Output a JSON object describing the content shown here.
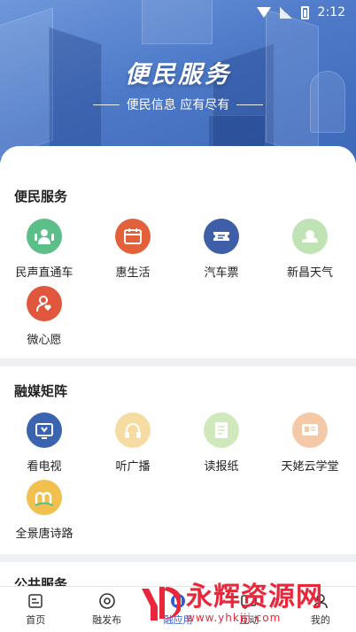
{
  "status_bar": {
    "time": "2:12"
  },
  "hero": {
    "title": "便民服务",
    "subtitle": "便民信息 应有尽有"
  },
  "sections": [
    {
      "title": "便民服务",
      "items": [
        {
          "label": "民声直通车",
          "icon": "people-voice-icon",
          "color": "#5cbf8a"
        },
        {
          "label": "惠生活",
          "icon": "calendar-life-icon",
          "color": "#e2613a"
        },
        {
          "label": "汽车票",
          "icon": "ticket-icon",
          "color": "#3e5ea8"
        },
        {
          "label": "新昌天气",
          "icon": "weather-icon",
          "color": "#bfe3b4"
        },
        {
          "label": "微心愿",
          "icon": "heart-wish-icon",
          "color": "#e0573e"
        }
      ]
    },
    {
      "title": "融媒矩阵",
      "items": [
        {
          "label": "看电视",
          "icon": "tv-icon",
          "color": "#3a63b0"
        },
        {
          "label": "听广播",
          "icon": "headphones-icon",
          "color": "#f6dca3"
        },
        {
          "label": "读报纸",
          "icon": "newspaper-icon",
          "color": "#cfe9bd"
        },
        {
          "label": "天姥云学堂",
          "icon": "classroom-icon",
          "color": "#f4c9a8"
        },
        {
          "label": "全景唐诗路",
          "icon": "panorama-icon",
          "color": "#f1c04e"
        }
      ]
    },
    {
      "title": "公共服务",
      "items": []
    }
  ],
  "tabbar": [
    {
      "label": "首页",
      "icon": "home-icon",
      "active": false
    },
    {
      "label": "融发布",
      "icon": "publish-icon",
      "active": false
    },
    {
      "label": "融应用",
      "icon": "apps-icon",
      "active": true
    },
    {
      "label": "互动",
      "icon": "interact-icon",
      "active": false
    },
    {
      "label": "我的",
      "icon": "profile-icon",
      "active": false
    }
  ],
  "watermark": {
    "text": "永辉资源网",
    "url": "www.yhkjjj.com"
  },
  "colors": {
    "accent": "#2f5bd3",
    "hero_blue": "#4d79c8",
    "watermark_red": "#e8283a"
  }
}
